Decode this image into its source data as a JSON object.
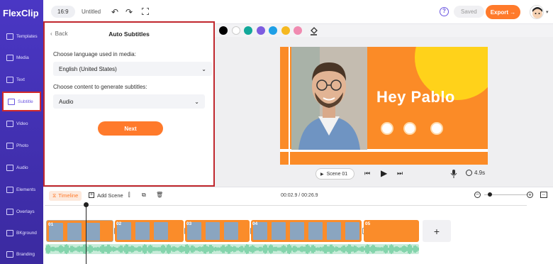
{
  "app": {
    "logo": "FlexClip"
  },
  "sidebar": {
    "items": [
      {
        "label": "Templates",
        "icon": "templates-icon"
      },
      {
        "label": "Media",
        "icon": "media-icon"
      },
      {
        "label": "Text",
        "icon": "text-icon"
      },
      {
        "label": "Subtitle",
        "icon": "subtitle-icon",
        "active": true
      },
      {
        "label": "Video",
        "icon": "video-icon"
      },
      {
        "label": "Photo",
        "icon": "photo-icon"
      },
      {
        "label": "Audio",
        "icon": "audio-icon"
      },
      {
        "label": "Elements",
        "icon": "elements-icon"
      },
      {
        "label": "Overlays",
        "icon": "overlays-icon"
      },
      {
        "label": "BKground",
        "icon": "background-icon"
      },
      {
        "label": "Branding",
        "icon": "branding-icon"
      }
    ]
  },
  "topbar": {
    "ratio": "16:9",
    "title": "Untitled",
    "saved": "Saved",
    "export": "Export →"
  },
  "panel": {
    "back": "Back",
    "title": "Auto Subtitles",
    "lang_label": "Choose language used in media:",
    "lang_value": "English (United States)",
    "content_label": "Choose content to generate subtitles:",
    "content_value": "Audio",
    "next": "Next"
  },
  "colors": [
    "#000000",
    "#ffffff",
    "#12a89a",
    "#7d5ce0",
    "#1e9fe6",
    "#f5b820",
    "#f08ab0"
  ],
  "preview": {
    "headline": "Hey Pablo",
    "scene": "Scene 01",
    "duration": "4.9s"
  },
  "timeline": {
    "tab": "Timeline",
    "add_scene": "Add Scene",
    "time": "00:02.9 / 00:26.9",
    "clips": [
      "01",
      "02",
      "03",
      "04",
      "05"
    ]
  },
  "accent": "#ff7a2b",
  "sidebar_color": "#3f2fa8",
  "highlight": "#c0272d"
}
